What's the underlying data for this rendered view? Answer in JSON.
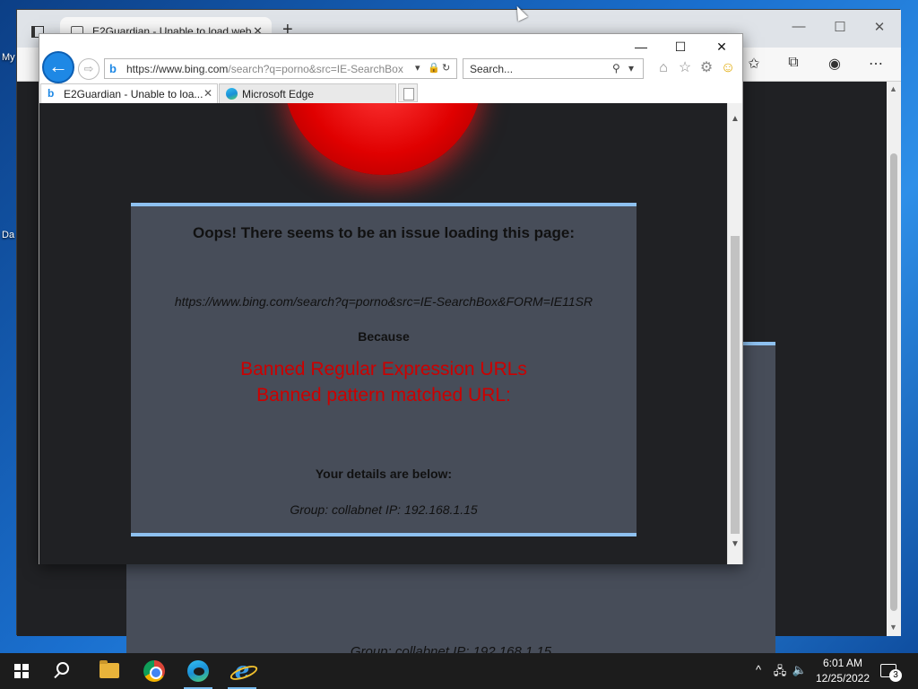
{
  "desktop": {
    "labels": [
      "My",
      "Da"
    ]
  },
  "edge": {
    "tab_title": "E2Guardian - Unable to load web",
    "new_tab_glyph": "+",
    "bg_details": "Group: collabnet   IP: 192.168.1.15"
  },
  "ie": {
    "address": {
      "url_main": "https://www.bing.com",
      "url_rest": "/search?q=porno&src=IE-SearchBox"
    },
    "search": {
      "placeholder": "Search..."
    },
    "tabs": [
      {
        "label": "E2Guardian - Unable to loa..."
      },
      {
        "label": "Microsoft Edge"
      }
    ]
  },
  "page": {
    "heading": "Oops! There seems to be an issue loading this page:",
    "blocked_url": "https://www.bing.com/search?q=porno&src=IE-SearchBox&FORM=IE11SR",
    "because": "Because",
    "reason_line1": "Banned Regular Expression URLs",
    "reason_line2": "Banned pattern matched URL:",
    "details_heading": "Your details are below:",
    "details": "Group: collabnet   IP: 192.168.1.15"
  },
  "taskbar": {
    "time": "6:01 AM",
    "date": "12/25/2022",
    "notification_count": "3"
  },
  "colors": {
    "accent_border": "#8ec1f0",
    "reason_red": "#cc0000",
    "card_bg": "#474d59",
    "page_bg": "#202124"
  }
}
